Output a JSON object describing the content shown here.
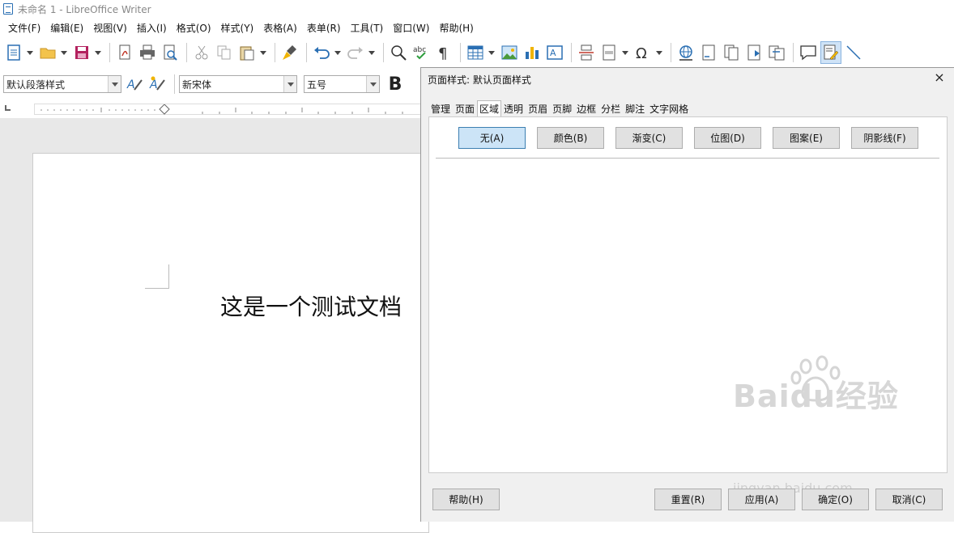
{
  "window": {
    "title": "未命名 1 - LibreOffice Writer"
  },
  "menubar": {
    "items": [
      "文件(F)",
      "编辑(E)",
      "视图(V)",
      "插入(I)",
      "格式(O)",
      "样式(Y)",
      "表格(A)",
      "表单(R)",
      "工具(T)",
      "窗口(W)",
      "帮助(H)"
    ]
  },
  "formatbar": {
    "paragraph_style": "默认段落样式",
    "font_name": "新宋体",
    "font_size": "五号",
    "bold_label": "B"
  },
  "document": {
    "body_text": "这是一个测试文档"
  },
  "dialog": {
    "title": "页面样式: 默认页面样式",
    "close_label": "×",
    "tabs": [
      "管理",
      "页面",
      "区域",
      "透明",
      "页眉",
      "页脚",
      "边框",
      "分栏",
      "脚注",
      "文字网格"
    ],
    "selected_tab": "区域",
    "fill_buttons": [
      "无(A)",
      "颜色(B)",
      "渐变(C)",
      "位图(D)",
      "图案(E)",
      "阴影线(F)"
    ],
    "selected_fill": "无(A)",
    "buttons": {
      "help": "帮助(H)",
      "reset": "重置(R)",
      "apply": "应用(A)",
      "ok": "确定(O)",
      "cancel": "取消(C)"
    }
  },
  "watermark": {
    "brand": "Baidu经验",
    "url": "jingyan.baidu.com"
  },
  "colors": {
    "accent": "#2a6fb3",
    "selected_bg": "#cce4f7",
    "dialog_bg": "#f0f0f0"
  }
}
